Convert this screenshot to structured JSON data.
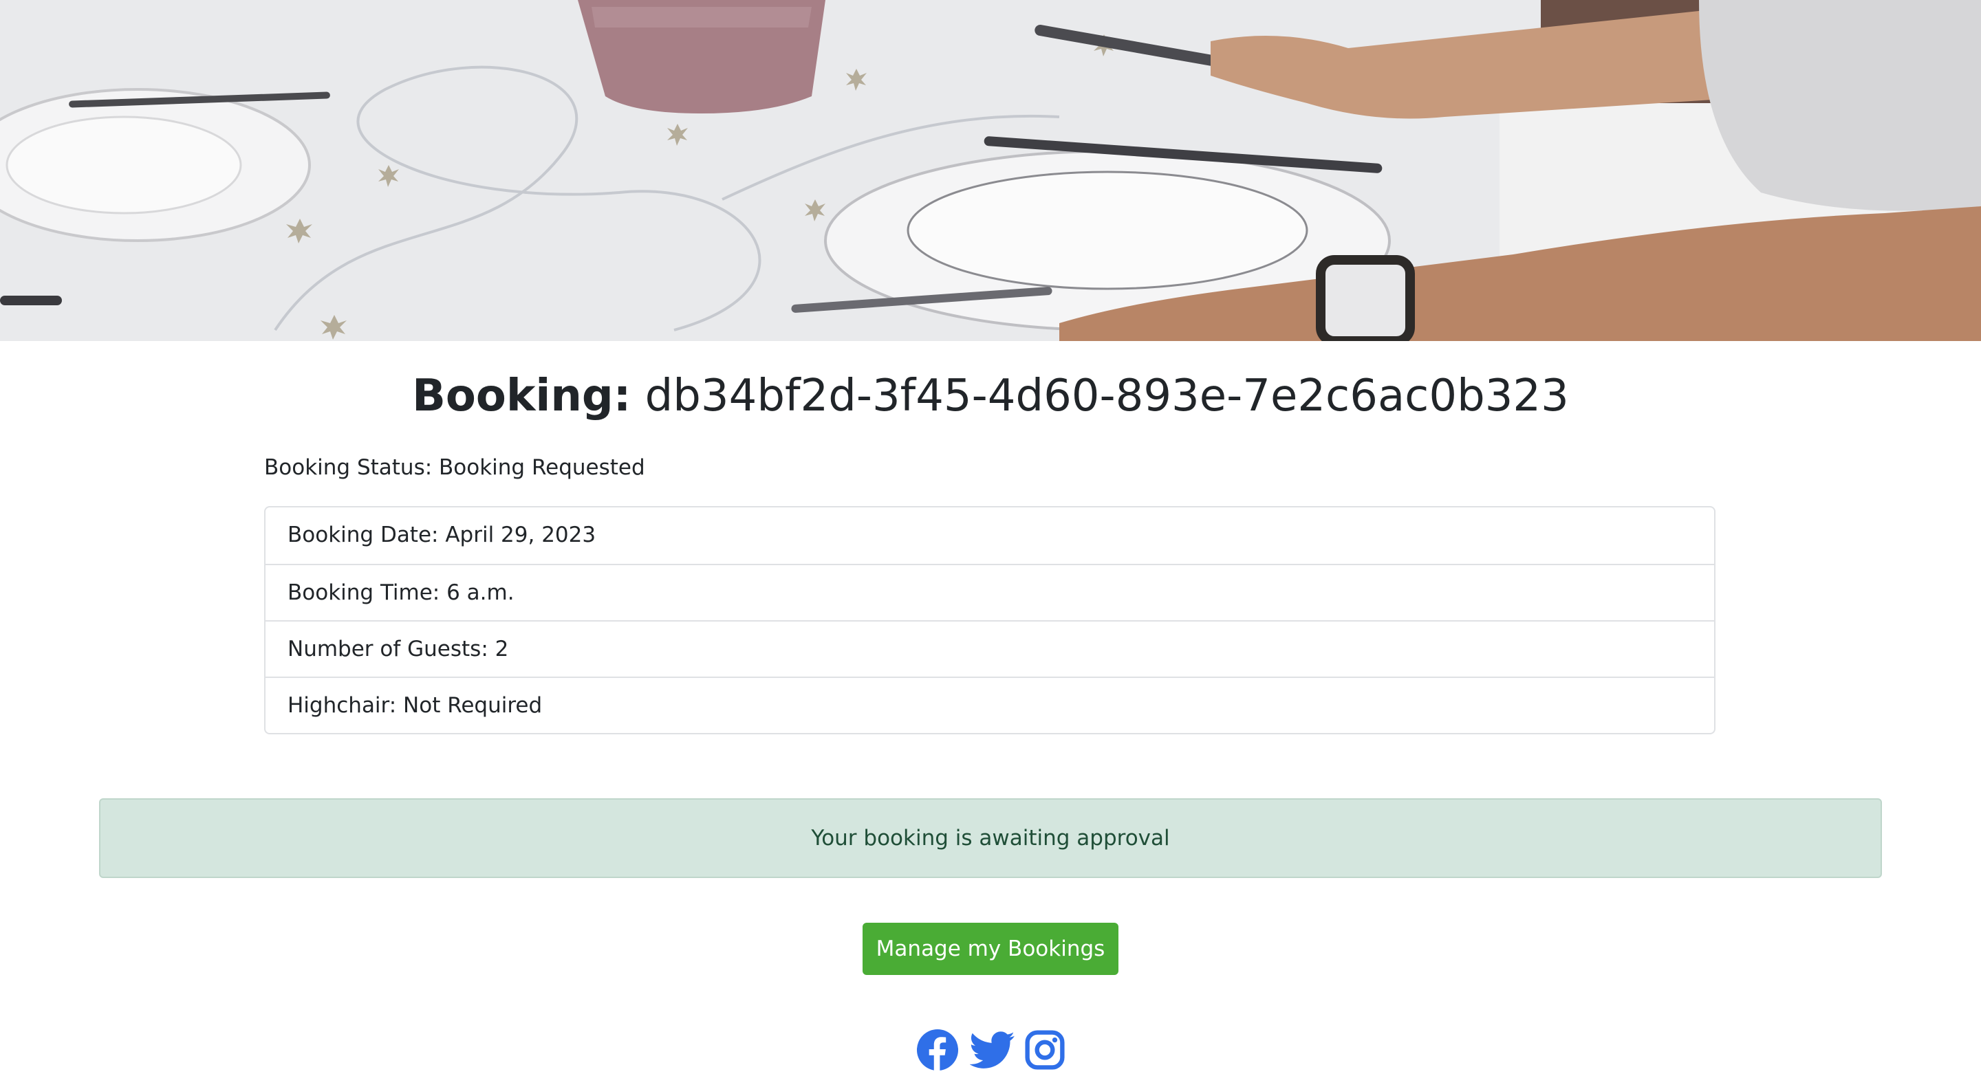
{
  "hero": {
    "image": "dining-table-place-settings-photo"
  },
  "booking": {
    "title_label": "Booking:",
    "title_id": "db34bf2d-3f45-4d60-893e-7e2c6ac0b323",
    "status": "Booking Status: Booking Requested",
    "details": [
      "Booking Date: April 29, 2023",
      "Booking Time: 6 a.m.",
      "Number of Guests: 2",
      "Highchair: Not Required"
    ]
  },
  "alert": {
    "message": "Your booking is awaiting approval"
  },
  "actions": {
    "manage_label": "Manage my Bookings"
  },
  "social": {
    "icons": [
      "facebook-icon",
      "twitter-icon",
      "instagram-icon"
    ],
    "color": "#2f6fe8"
  },
  "colors": {
    "alert_bg": "#d4e6de",
    "alert_text": "#1f4e37",
    "button_bg": "#4aac35"
  }
}
